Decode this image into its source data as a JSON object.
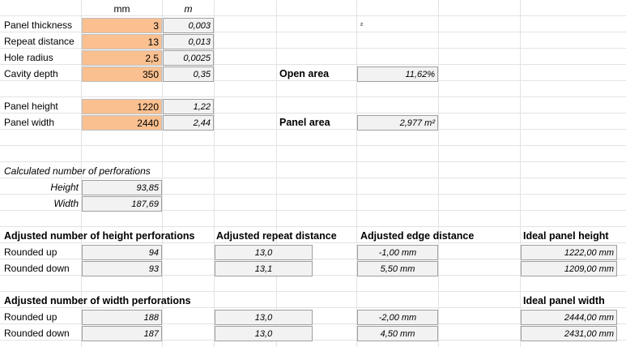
{
  "headers": {
    "mm": "mm",
    "m": "m"
  },
  "inputs": [
    {
      "label": "Panel thickness",
      "mm": "3",
      "m": "0,003"
    },
    {
      "label": "Repeat distance",
      "mm": "13",
      "m": "0,013"
    },
    {
      "label": "Hole radius",
      "mm": "2,5",
      "m": "0,0025"
    },
    {
      "label": "Cavity depth",
      "mm": "350",
      "m": "0,35"
    }
  ],
  "stray_mark": "²",
  "open_area": {
    "label": "Open area",
    "value": "11,62%"
  },
  "panel_inputs": [
    {
      "label": "Panel height",
      "mm": "1220",
      "m": "1,22"
    },
    {
      "label": "Panel width",
      "mm": "2440",
      "m": "2,44"
    }
  ],
  "panel_area": {
    "label": "Panel area",
    "value": "2,977 m²"
  },
  "perforations": {
    "title": "Calculated number of perforations",
    "rows": [
      {
        "label": "Height",
        "value": "93,85"
      },
      {
        "label": "Width",
        "value": "187,69"
      }
    ]
  },
  "height_section": {
    "title": "Adjusted number of height perforations",
    "repeat_header": "Adjusted repeat distance",
    "edge_header": "Adjusted edge distance",
    "ideal_header": "Ideal panel height",
    "rows": [
      {
        "label": "Rounded up",
        "count": "94",
        "repeat": "13,0",
        "edge": "-1,00 mm",
        "ideal": "1222,00 mm"
      },
      {
        "label": "Rounded down",
        "count": "93",
        "repeat": "13,1",
        "edge": "5,50 mm",
        "ideal": "1209,00 mm"
      }
    ]
  },
  "width_section": {
    "title": "Adjusted number of width perforations",
    "ideal_header": "Ideal panel width",
    "rows": [
      {
        "label": "Rounded up",
        "count": "188",
        "repeat": "13,0",
        "edge": "-2,00 mm",
        "ideal": "2444,00 mm"
      },
      {
        "label": "Rounded down",
        "count": "187",
        "repeat": "13,0",
        "edge": "4,50 mm",
        "ideal": "2431,00 mm"
      }
    ]
  }
}
